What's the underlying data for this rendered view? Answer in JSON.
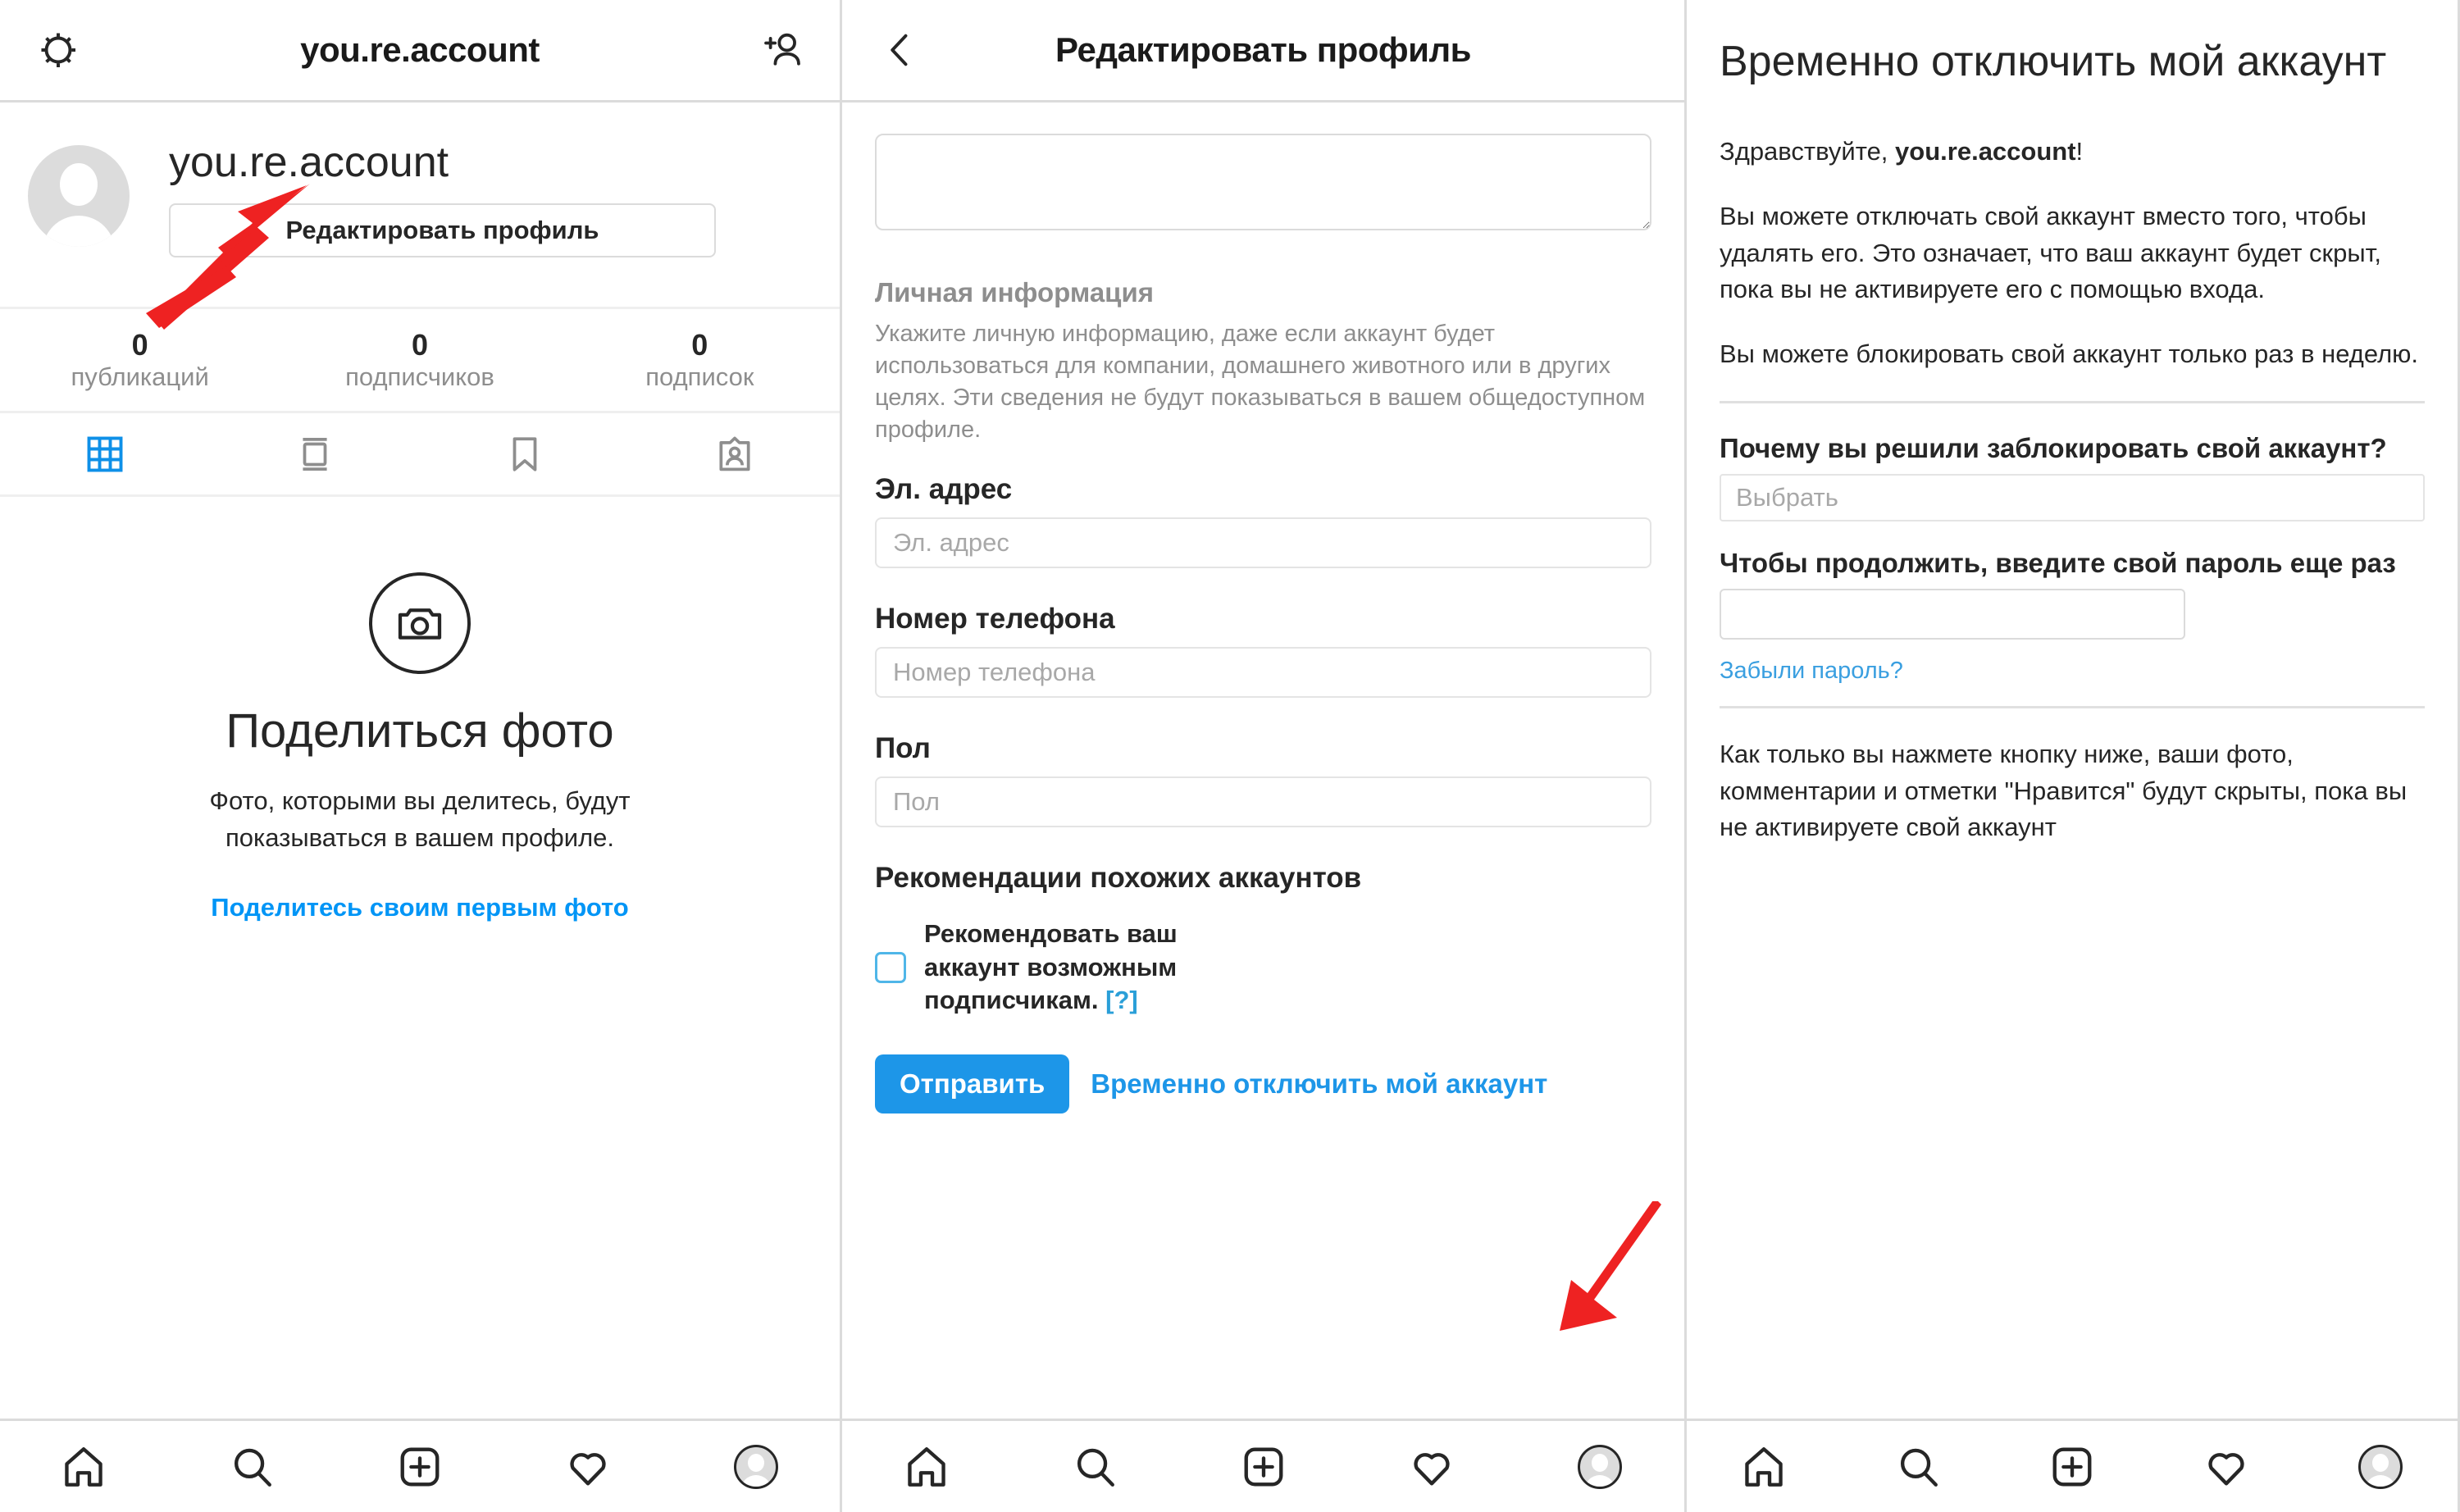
{
  "panel_profile": {
    "topbar": {
      "settings_icon": "gear-icon",
      "title": "you.re.account",
      "add_person_icon": "add-person-icon"
    },
    "username": "you.re.account",
    "edit_profile_button": "Редактировать профиль",
    "stats": [
      {
        "num": "0",
        "label": "публикаций"
      },
      {
        "num": "0",
        "label": "подписчиков"
      },
      {
        "num": "0",
        "label": "подписок"
      }
    ],
    "tabs": [
      {
        "icon": "grid-icon",
        "active": true
      },
      {
        "icon": "igtv-icon",
        "active": false
      },
      {
        "icon": "bookmark-icon",
        "active": false
      },
      {
        "icon": "tagged-person-icon",
        "active": false
      }
    ],
    "share": {
      "icon": "camera-icon",
      "title": "Поделиться фото",
      "description": "Фото, которыми вы делитесь, будут показываться в вашем профиле.",
      "link": "Поделитесь своим первым фото"
    }
  },
  "panel_edit": {
    "topbar": {
      "back_icon": "chevron-left-icon",
      "title": "Редактировать профиль"
    },
    "bio_value": "",
    "section": {
      "title": "Личная информация",
      "description": "Укажите личную информацию, даже если аккаунт будет использоваться для компании, домашнего животного или в других целях. Эти сведения не будут показываться в вашем общедоступном профиле."
    },
    "fields": [
      {
        "label": "Эл. адрес",
        "placeholder": "Эл. адрес",
        "value": ""
      },
      {
        "label": "Номер телефона",
        "placeholder": "Номер телефона",
        "value": ""
      },
      {
        "label": "Пол",
        "placeholder": "Пол",
        "value": ""
      }
    ],
    "recommendations": {
      "title": "Рекомендации похожих аккаунтов",
      "checkbox_checked": false,
      "checkbox_label": "Рекомендовать ваш аккаунт возможным подписчикам.",
      "help_link": "[?]"
    },
    "submit_label": "Отправить",
    "disable_link": "Временно отключить мой аккаунт"
  },
  "panel_disable": {
    "title": "Временно отключить мой аккаунт",
    "greeting_prefix": "Здравствуйте, ",
    "greeting_name": "you.re.account",
    "greeting_suffix": "!",
    "paragraph_1": "Вы можете отключать свой аккаунт вместо того, чтобы удалять его. Это означает, что ваш аккаунт будет скрыт, пока вы не активируете его с помощью входа.",
    "paragraph_2": "Вы можете блокировать свой аккаунт только раз в неделю.",
    "reason_label": "Почему вы решили заблокировать свой аккаунт?",
    "reason_placeholder": "Выбрать",
    "password_label": "Чтобы продолжить, введите свой пароль еще раз",
    "password_value": "",
    "forgot_link": "Забыли пароль?",
    "footer_text": "Как только вы нажмете кнопку ниже, ваши фото, комментарии и отметки \"Нравится\" будут скрыты, пока вы не активируете свой аккаунт"
  },
  "bottom_nav": [
    {
      "icon": "home-icon",
      "label": "Главная"
    },
    {
      "icon": "search-icon",
      "label": "Поиск"
    },
    {
      "icon": "add-post-icon",
      "label": "Добавить"
    },
    {
      "icon": "heart-icon",
      "label": "Нравится"
    },
    {
      "icon": "profile-avatar-icon",
      "label": "Профиль"
    }
  ],
  "annotations": [
    {
      "name": "arrow-to-edit-profile-button",
      "color": "#ee2222"
    },
    {
      "name": "arrow-to-disable-account-link",
      "color": "#ee2222"
    }
  ],
  "colors": {
    "accent_blue": "#0095f6",
    "button_blue": "#1d96e8",
    "link_blue": "#3a9fe0",
    "text_dark": "#262626",
    "text_muted": "#8e8e8e",
    "border": "#dbdbdb",
    "arrow_red": "#ee2222"
  }
}
